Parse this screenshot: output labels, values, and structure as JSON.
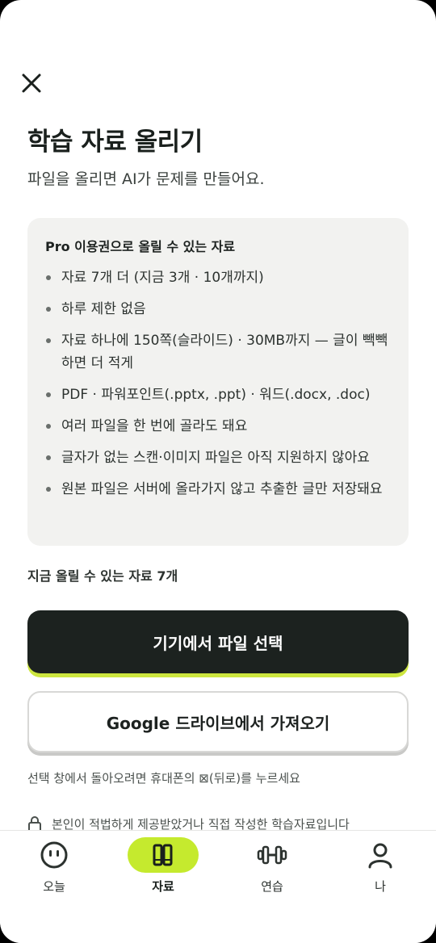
{
  "header": {
    "close_icon": "close-icon",
    "title": "학습 자료 올리기",
    "subtitle": "파일을 올리면 AI가 문제를 만들어요."
  },
  "info_card": {
    "title": "Pro 이용권으로 올릴 수 있는 자료",
    "items": [
      "자료 7개 더 (지금 3개 · 10개까지)",
      "하루 제한 없음",
      "자료 하나에 150쪽(슬라이드) · 30MB까지 — 글이 빽빽하면 더 적게",
      "PDF · 파워포인트(.pptx, .ppt) · 워드(.docx, .doc)",
      "여러 파일을 한 번에 골라도 돼요",
      "글자가 없는 스캔·이미지 파일은 아직 지원하지 않아요",
      "원본 파일은 서버에 올라가지 않고 추출한 글만 저장돼요"
    ]
  },
  "remaining_text": "지금 올릴 수 있는 자료 7개",
  "buttons": {
    "device_select": "기기에서 파일 선택",
    "google_drive": "Google 드라이브에서 가져오기"
  },
  "back_hint": "선택 창에서 돌아오려면 휴대폰의 ⊠(뒤로)를 누르세요",
  "consent_text": "본인이 적법하게 제공받았거나 직접 작성한 학습자료입니다",
  "tabbar": {
    "tabs": [
      {
        "label": "오늘",
        "icon": "smile-face-icon",
        "active": false
      },
      {
        "label": "자료",
        "icon": "books-icon",
        "active": true
      },
      {
        "label": "연습",
        "icon": "dumbbell-icon",
        "active": false
      },
      {
        "label": "나",
        "icon": "person-icon",
        "active": false
      }
    ]
  },
  "colors": {
    "accent": "#c5ea2e",
    "primary_button": "#1c221f",
    "card_background": "#f2f2f0"
  }
}
